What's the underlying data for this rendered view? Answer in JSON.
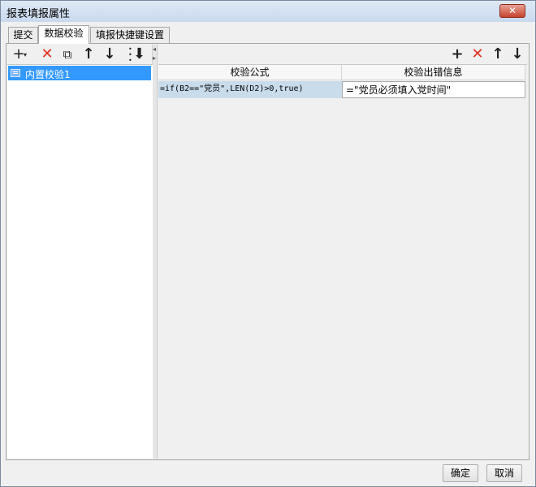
{
  "window": {
    "title": "报表填报属性",
    "close_glyph": "✕"
  },
  "tabs": [
    {
      "label": "提交",
      "active": false
    },
    {
      "label": "数据校验",
      "active": true
    },
    {
      "label": "填报快捷键设置",
      "active": false
    }
  ],
  "left_toolbar": {
    "buttons": [
      {
        "icon": "add-dropdown-icon",
        "glyph": "+"
      },
      {
        "icon": "delete-icon",
        "glyph": "✕"
      },
      {
        "icon": "copy-icon",
        "glyph": "⧉"
      },
      {
        "icon": "move-up-icon",
        "glyph": "↑"
      },
      {
        "icon": "move-down-icon",
        "glyph": "↓"
      },
      {
        "icon": "move-bottom-icon",
        "glyph": "⬇"
      }
    ]
  },
  "left_list": {
    "items": [
      {
        "label": "内置校验1",
        "selected": true
      }
    ]
  },
  "right_toolbar": {
    "buttons": [
      {
        "icon": "add-icon",
        "glyph": "+"
      },
      {
        "icon": "delete-icon",
        "glyph": "✕"
      },
      {
        "icon": "move-up-icon",
        "glyph": "↑"
      },
      {
        "icon": "move-down-icon",
        "glyph": "↓"
      }
    ]
  },
  "grid": {
    "columns": [
      "校验公式",
      "校验出错信息"
    ],
    "rows": [
      {
        "formula": "=if(B2==\"党员\",LEN(D2)>0,true)",
        "message": "=\"党员必须填入党时间\""
      }
    ]
  },
  "footer": {
    "ok_label": "确定",
    "cancel_label": "取消"
  },
  "colors": {
    "selection": "#3399ff",
    "formula_cell_bg": "#c9dcec",
    "delete_red": "#e0301e"
  }
}
